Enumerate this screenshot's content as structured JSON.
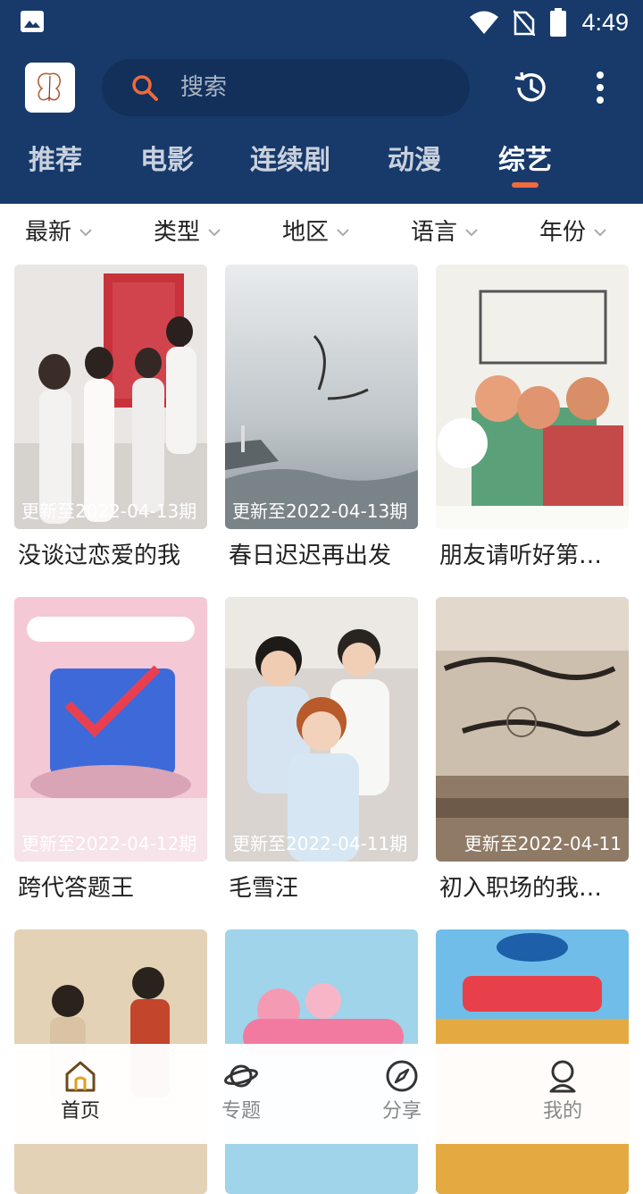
{
  "status_bar": {
    "time": "4:49"
  },
  "search": {
    "placeholder": "搜索"
  },
  "tabs": [
    {
      "label": "推荐"
    },
    {
      "label": "电影"
    },
    {
      "label": "连续剧"
    },
    {
      "label": "动漫"
    },
    {
      "label": "综艺",
      "active": true
    }
  ],
  "filters": [
    {
      "label": "最新"
    },
    {
      "label": "类型"
    },
    {
      "label": "地区"
    },
    {
      "label": "语言"
    },
    {
      "label": "年份"
    }
  ],
  "cards": [
    {
      "title": "没谈过恋爱的我",
      "badge": "更新至2022-04-13期"
    },
    {
      "title": "春日迟迟再出发",
      "badge": "更新至2022-04-13期"
    },
    {
      "title": "朋友请听好第…",
      "badge": ""
    },
    {
      "title": "跨代答题王",
      "badge": "更新至2022-04-12期"
    },
    {
      "title": "毛雪汪",
      "badge": "更新至2022-04-11期"
    },
    {
      "title": "初入职场的我…",
      "badge": "更新至2022-04-11"
    },
    {
      "title": "",
      "badge": ""
    },
    {
      "title": "",
      "badge": ""
    },
    {
      "title": "",
      "badge": ""
    }
  ],
  "bottom_nav": [
    {
      "label": "首页",
      "icon": "home-icon",
      "active": true
    },
    {
      "label": "专题",
      "icon": "planet-icon"
    },
    {
      "label": "分享",
      "icon": "compass-icon"
    },
    {
      "label": "我的",
      "icon": "profile-icon"
    }
  ],
  "colors": {
    "header_bg": "#173a6b",
    "accent": "#f06a3c"
  }
}
